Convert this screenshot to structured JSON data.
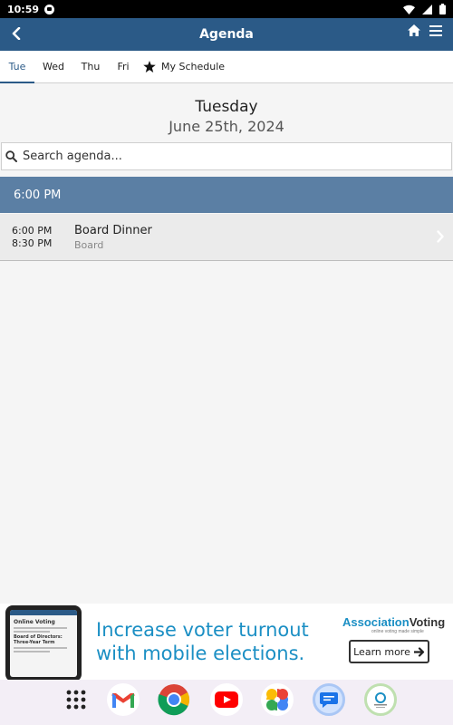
{
  "status_bar": {
    "time": "10:59",
    "icons": [
      "notification-icon",
      "wifi-icon",
      "signal-icon",
      "battery-icon"
    ]
  },
  "app_bar": {
    "title": "Agenda",
    "back_icon": "chevron-left-icon",
    "home_icon": "home-icon",
    "menu_icon": "hamburger-menu-icon",
    "color": "#2b5a87"
  },
  "tabs": [
    {
      "label": "Tue",
      "active": true
    },
    {
      "label": "Wed",
      "active": false
    },
    {
      "label": "Thu",
      "active": false
    },
    {
      "label": "Fri",
      "active": false
    },
    {
      "label": "My Schedule",
      "active": false,
      "icon": "star-icon"
    }
  ],
  "date_header": {
    "day_of_week": "Tuesday",
    "date": "June 25th, 2024"
  },
  "search": {
    "placeholder": "Search agenda..."
  },
  "time_groups": [
    {
      "time": "6:00 PM",
      "color": "#5b7fa4",
      "sessions": [
        {
          "start": "6:00 PM",
          "end": "8:30 PM",
          "name": "Board Dinner",
          "track": "Board"
        }
      ]
    }
  ],
  "ad": {
    "headline_line1": "Increase voter turnout",
    "headline_line2": "with mobile elections.",
    "brand_part1": "Association",
    "brand_part2": "Voting",
    "tagline": "online voting made simple",
    "button_label": "Learn more",
    "phone_title": "Online Voting",
    "phone_subtitle": "Board of Directors: Three-Year Term",
    "accent_color": "#1b8fc4"
  },
  "dock": {
    "apps": [
      "app-drawer-icon",
      "gmail-icon",
      "chrome-icon",
      "youtube-icon",
      "photos-icon",
      "messages-icon",
      "association-app-icon"
    ]
  }
}
